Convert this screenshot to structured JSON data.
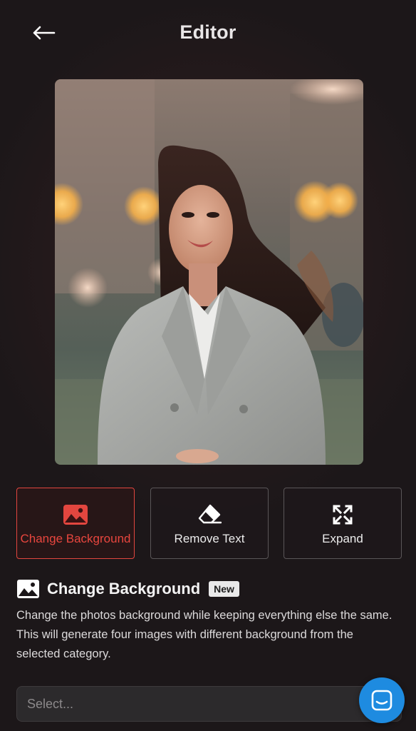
{
  "header": {
    "title": "Editor",
    "back_icon": "arrow-left-icon"
  },
  "photo": {
    "alt": ""
  },
  "tools": [
    {
      "label": "Change Background",
      "icon": "image-icon",
      "active": true
    },
    {
      "label": "Remove Text",
      "icon": "eraser-icon",
      "active": false
    },
    {
      "label": "Expand",
      "icon": "expand-icon",
      "active": false
    }
  ],
  "section": {
    "title": "Change Background",
    "icon": "image-icon",
    "badge": "New",
    "description": "Change the photos background while keeping everything else the same. This will generate four images with different background from the selected category."
  },
  "select": {
    "placeholder": "Select..."
  },
  "chat": {
    "icon": "chat-icon"
  },
  "colors": {
    "accent": "#e2463f",
    "chat": "#1e8be0",
    "background": "#1b1618"
  }
}
